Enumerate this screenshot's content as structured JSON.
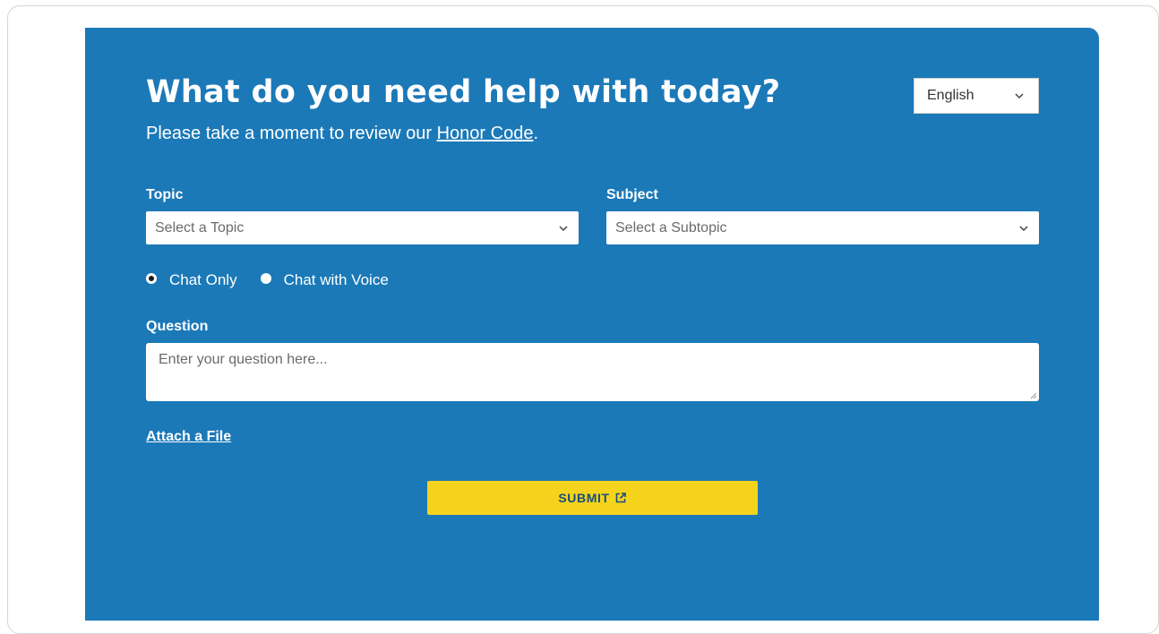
{
  "header": {
    "title": "What do you need help with today?",
    "subtitle_prefix": "Please take a moment to review our ",
    "honor_code_link": "Honor Code",
    "subtitle_suffix": "."
  },
  "language": {
    "selected": "English"
  },
  "form": {
    "topic": {
      "label": "Topic",
      "placeholder": "Select a Topic"
    },
    "subject": {
      "label": "Subject",
      "placeholder": "Select a Subtopic"
    },
    "mode": {
      "options": [
        {
          "label": "Chat Only",
          "checked": true
        },
        {
          "label": "Chat with Voice",
          "checked": false
        }
      ]
    },
    "question": {
      "label": "Question",
      "placeholder": "Enter your question here..."
    },
    "attach_label": "Attach a File",
    "submit_label": "SUBMIT"
  },
  "colors": {
    "panel": "#1b79b8",
    "submit": "#f5d31c"
  },
  "icons": {
    "dropdown": "chevron-down-icon",
    "submit": "external-link-icon",
    "resize": "resize-grip-icon"
  }
}
